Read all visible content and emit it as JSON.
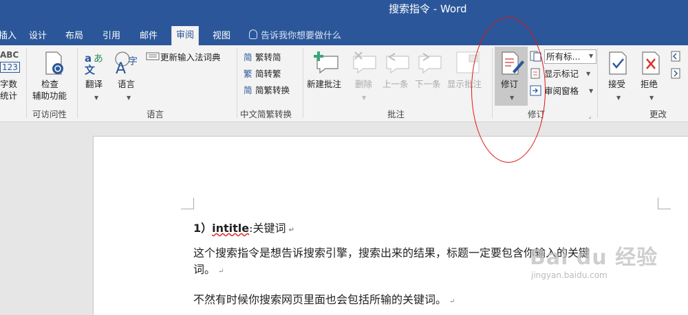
{
  "window": {
    "title": "搜索指令 - Word"
  },
  "tabs": [
    {
      "label": "插入",
      "active": false
    },
    {
      "label": "设计",
      "active": false
    },
    {
      "label": "布局",
      "active": false
    },
    {
      "label": "引用",
      "active": false
    },
    {
      "label": "邮件",
      "active": false
    },
    {
      "label": "审阅",
      "active": true
    },
    {
      "label": "视图",
      "active": false
    }
  ],
  "tell_me": "告诉我你想要做什么",
  "ribbon": {
    "word_count": {
      "label_top": "ABC",
      "label_num": "123",
      "label1": "字数",
      "label2": "统计"
    },
    "accessibility": {
      "label1": "检查",
      "label2": "辅助功能",
      "group": "可访问性"
    },
    "language": {
      "translate": "翻译",
      "language": "语言",
      "update_ime": "更新输入法词典",
      "group": "语言"
    },
    "chinese": {
      "trad_to_simp": "繁转简",
      "simp_to_trad": "简转繁",
      "convert": "简繁转换",
      "group": "中文简繁转换"
    },
    "comments": {
      "new": "新建批注",
      "delete": "删除",
      "previous": "上一条",
      "next": "下一条",
      "show": "显示批注",
      "group": "批注"
    },
    "tracking": {
      "track": "修订",
      "all_markup": "所有标...",
      "show_markup": "显示标记",
      "review_pane": "审阅窗格",
      "group": "修订"
    },
    "changes": {
      "accept": "接受",
      "reject": "拒绝",
      "group": "更改"
    }
  },
  "document": {
    "heading_num": "1）",
    "heading_cmd": "intitle",
    "heading_rest": ":关键词",
    "para1": "这个搜索指令是想告诉搜索引擎，搜索出来的结果，标题一定要包含你输入的关键",
    "para1_cont": "词。",
    "para2": "不然有时候你搜索网页里面也会包括所输的关键词。",
    "para_mark": "↵"
  },
  "watermark": {
    "main": "Bai du 经验",
    "sub": "jingyan.baidu.com"
  },
  "colors": {
    "titlebar": "#2b579a",
    "ribbon": "#f3f3f3",
    "annotation": "#e21212"
  }
}
